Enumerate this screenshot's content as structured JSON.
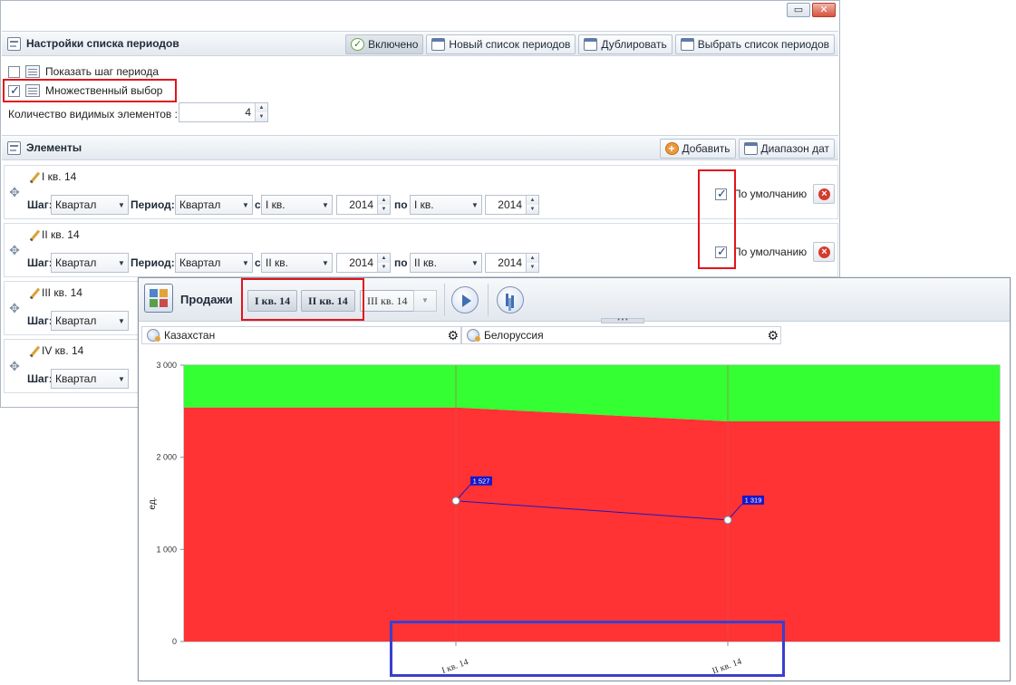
{
  "settings": {
    "section_title": "Настройки списка периодов",
    "toolbar": {
      "enabled_label": "Включено",
      "new_list_label": "Новый список периодов",
      "duplicate_label": "Дублировать",
      "choose_list_label": "Выбрать список периодов"
    },
    "show_step_label": "Показать шаг периода",
    "show_step_checked": false,
    "multi_select_label": "Множественный выбор",
    "multi_select_checked": true,
    "visible_count_label": "Количество видимых элементов :",
    "visible_count_value": "4",
    "elements_title": "Элементы",
    "add_label": "Добавить",
    "date_range_label": "Диапазон дат",
    "labels": {
      "step": "Шаг:",
      "period": "Период:",
      "from": "с",
      "to": "по",
      "default": "По умолчанию"
    },
    "rows": [
      {
        "name": "I кв. 14",
        "step": "Квартал",
        "period": "Квартал",
        "from_q": "I кв.",
        "from_year": "2014",
        "to_q": "I кв.",
        "to_year": "2014",
        "default": true
      },
      {
        "name": "II кв. 14",
        "step": "Квартал",
        "period": "Квартал",
        "from_q": "II кв.",
        "from_year": "2014",
        "to_q": "II кв.",
        "to_year": "2014",
        "default": true
      },
      {
        "name": "III кв. 14",
        "step": "Квартал",
        "period": ""
      },
      {
        "name": "IV кв. 14",
        "step": "Квартал",
        "period": ""
      }
    ]
  },
  "chartwin": {
    "title": "Продажи",
    "periods": [
      {
        "label": "I кв. 14",
        "selected": true
      },
      {
        "label": "II кв. 14",
        "selected": true
      },
      {
        "label": "III кв. 14",
        "selected": false
      }
    ],
    "regions": [
      "Казахстан",
      "Белоруссия"
    ],
    "icons": {
      "gear": "gear-icon",
      "play": "play-icon",
      "settings": "chart-settings-icon"
    }
  },
  "chart_data": {
    "type": "area",
    "x": [
      "I кв. 14",
      "II кв. 14"
    ],
    "ylabel": "ед.",
    "ylim": [
      0,
      3000
    ],
    "yticks": [
      "0",
      "1 000",
      "2 000",
      "3 000"
    ],
    "series": [
      {
        "name": "",
        "kind": "area",
        "color": "#ff3333",
        "values": [
          2540,
          2390
        ]
      },
      {
        "name": "",
        "kind": "area",
        "color": "#33ff33",
        "values": [
          3000,
          3000
        ]
      },
      {
        "name": "",
        "kind": "line",
        "color": "#1a17c9",
        "values": [
          1527,
          1319
        ],
        "labels": [
          "1 527",
          "1 319"
        ]
      }
    ],
    "grid": true
  }
}
